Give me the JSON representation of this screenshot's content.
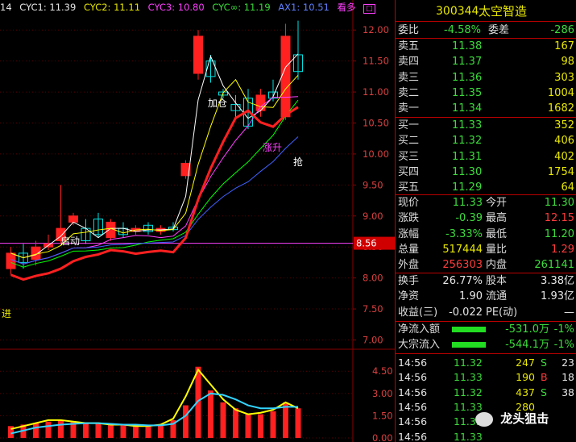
{
  "topbar": {
    "period": "14",
    "cyc1": "CYC1: 11.39",
    "cyc2": "CYC2: 11.11",
    "cyc3": "CYC3: 10.80",
    "cycinf": "CYC∞: 11.19",
    "ax1": "AX1: 10.51",
    "look_more": "看多"
  },
  "annotations": {
    "jiacang": "加仓",
    "zhangsheng": "涨升",
    "qiang": "抢",
    "qidong": "启动",
    "jin": "进"
  },
  "price_axis": [
    "12.00",
    "11.50",
    "11.00",
    "10.50",
    "10.00",
    "9.50",
    "9.00",
    "8.50",
    "8.00",
    "7.50",
    "7.00"
  ],
  "current_price_tag": "8.56",
  "indicator_axis": [
    "4.50",
    "3.00",
    "1.50",
    "0.00"
  ],
  "chart_data": {
    "type": "candlestick",
    "ylim": [
      6.85,
      12.25
    ],
    "candles": [
      {
        "o": 8.15,
        "c": 8.4,
        "h": 8.5,
        "l": 8.05
      },
      {
        "o": 8.4,
        "c": 8.25,
        "h": 8.55,
        "l": 8.15
      },
      {
        "o": 8.3,
        "c": 8.5,
        "h": 8.6,
        "l": 8.2
      },
      {
        "o": 8.5,
        "c": 8.55,
        "h": 8.7,
        "l": 8.45
      },
      {
        "o": 8.6,
        "c": 8.8,
        "h": 9.5,
        "l": 8.55
      },
      {
        "o": 8.9,
        "c": 9.0,
        "h": 9.05,
        "l": 8.85
      },
      {
        "o": 8.8,
        "c": 8.6,
        "h": 8.95,
        "l": 8.55
      },
      {
        "o": 8.95,
        "c": 8.7,
        "h": 9.05,
        "l": 8.65
      },
      {
        "o": 8.65,
        "c": 8.9,
        "h": 8.95,
        "l": 8.6
      },
      {
        "o": 8.8,
        "c": 8.7,
        "h": 8.9,
        "l": 8.65
      },
      {
        "o": 8.75,
        "c": 8.8,
        "h": 8.85,
        "l": 8.7
      },
      {
        "o": 8.85,
        "c": 8.75,
        "h": 8.9,
        "l": 8.7
      },
      {
        "o": 8.75,
        "c": 8.8,
        "h": 8.85,
        "l": 8.7
      },
      {
        "o": 8.82,
        "c": 8.78,
        "h": 8.9,
        "l": 8.75
      },
      {
        "o": 9.65,
        "c": 9.85,
        "h": 9.9,
        "l": 9.6
      },
      {
        "o": 11.3,
        "c": 11.9,
        "h": 12.0,
        "l": 11.2
      },
      {
        "o": 11.5,
        "c": 11.25,
        "h": 11.6,
        "l": 11.15
      },
      {
        "o": 11.0,
        "c": 10.95,
        "h": 11.05,
        "l": 10.9
      },
      {
        "o": 10.8,
        "c": 10.7,
        "h": 10.95,
        "l": 10.6
      },
      {
        "o": 10.9,
        "c": 10.45,
        "h": 11.05,
        "l": 10.4
      },
      {
        "o": 10.7,
        "c": 10.95,
        "h": 11.05,
        "l": 10.6
      },
      {
        "o": 11.0,
        "c": 10.9,
        "h": 11.2,
        "l": 10.85
      },
      {
        "o": 10.6,
        "c": 11.9,
        "h": 12.1,
        "l": 10.55
      },
      {
        "o": 11.6,
        "c": 11.33,
        "h": 12.15,
        "l": 11.2
      }
    ],
    "indicator": {
      "ylim": [
        0,
        5.6
      ],
      "bars": [
        0.8,
        0.9,
        1.0,
        1.1,
        1.2,
        1.1,
        1.0,
        1.0,
        0.9,
        0.9,
        0.8,
        0.8,
        0.9,
        1.2,
        2.2,
        4.8,
        3.2,
        2.4,
        2.0,
        1.6,
        1.6,
        1.8,
        2.4,
        2.0
      ],
      "line1": [
        0.6,
        0.8,
        1.0,
        1.2,
        1.2,
        1.1,
        1.0,
        1.0,
        0.9,
        0.9,
        0.8,
        0.8,
        0.9,
        1.3,
        2.8,
        4.6,
        3.6,
        2.6,
        1.9,
        1.6,
        1.7,
        1.9,
        2.4,
        2.0
      ],
      "line2": [
        0.3,
        0.5,
        0.7,
        0.8,
        0.9,
        0.95,
        1.0,
        1.0,
        0.95,
        0.9,
        0.9,
        0.85,
        0.85,
        0.95,
        1.5,
        2.5,
        3.0,
        2.9,
        2.6,
        2.2,
        2.0,
        2.0,
        2.1,
        2.1
      ]
    }
  },
  "stock": {
    "code": "300344",
    "name": "太空智造"
  },
  "weibi": {
    "label": "委比",
    "value": "-4.58%",
    "label2": "委差",
    "value2": "-286"
  },
  "asks": [
    {
      "label": "卖五",
      "price": "11.38",
      "vol": "167"
    },
    {
      "label": "卖四",
      "price": "11.37",
      "vol": "98"
    },
    {
      "label": "卖三",
      "price": "11.36",
      "vol": "303"
    },
    {
      "label": "卖二",
      "price": "11.35",
      "vol": "1004"
    },
    {
      "label": "卖一",
      "price": "11.34",
      "vol": "1682"
    }
  ],
  "bids": [
    {
      "label": "买一",
      "price": "11.33",
      "vol": "352"
    },
    {
      "label": "买二",
      "price": "11.32",
      "vol": "406"
    },
    {
      "label": "买三",
      "price": "11.31",
      "vol": "402"
    },
    {
      "label": "买四",
      "price": "11.30",
      "vol": "1754"
    },
    {
      "label": "买五",
      "price": "11.29",
      "vol": "64"
    }
  ],
  "quote": [
    {
      "l1": "现价",
      "v1": "11.33",
      "l2": "今开",
      "v2": "11.30",
      "c1": "green",
      "c2": "green"
    },
    {
      "l1": "涨跌",
      "v1": "-0.39",
      "l2": "最高",
      "v2": "12.15",
      "c1": "green",
      "c2": "red"
    },
    {
      "l1": "涨幅",
      "v1": "-3.33%",
      "l2": "最低",
      "v2": "11.20",
      "c1": "green",
      "c2": "green"
    },
    {
      "l1": "总量",
      "v1": "517444",
      "l2": "量比",
      "v2": "1.29",
      "c1": "yellow",
      "c2": "red"
    },
    {
      "l1": "外盘",
      "v1": "256303",
      "l2": "内盘",
      "v2": "261141",
      "c1": "red",
      "c2": "green"
    }
  ],
  "fundamentals": [
    {
      "l1": "换手",
      "v1": "26.77%",
      "l2": "股本",
      "v2": "3.38亿"
    },
    {
      "l1": "净资",
      "v1": "1.90",
      "l2": "流通",
      "v2": "1.93亿"
    },
    {
      "l1": "收益(三)",
      "v1": "-0.022",
      "l2": "PE(动)",
      "v2": "—"
    }
  ],
  "flows": [
    {
      "label": "净流入额",
      "value": "-531.0万",
      "pct": "-1%",
      "fill": 0.6
    },
    {
      "label": "大宗流入",
      "value": "-544.1万",
      "pct": "-1%",
      "fill": 0.6
    }
  ],
  "ticks": [
    {
      "time": "14:56",
      "price": "11.32",
      "vol": "247",
      "side": "S",
      "n": "23",
      "pc": "green",
      "sc": "green"
    },
    {
      "time": "14:56",
      "price": "11.33",
      "vol": "190",
      "side": "B",
      "n": "18",
      "pc": "green",
      "sc": "red"
    },
    {
      "time": "14:56",
      "price": "11.32",
      "vol": "437",
      "side": "S",
      "n": "38",
      "pc": "green",
      "sc": "green"
    },
    {
      "time": "14:56",
      "price": "11.33",
      "vol": "280",
      "side": "",
      "n": "",
      "pc": "green",
      "sc": "green"
    },
    {
      "time": "14:56",
      "price": "11.33",
      "vol": "",
      "side": "",
      "n": "",
      "pc": "green",
      "sc": "green"
    },
    {
      "time": "14:56",
      "price": "11.33",
      "vol": "",
      "side": "",
      "n": "",
      "pc": "green",
      "sc": "green"
    }
  ],
  "watermark": "龙头狙击",
  "colors": {
    "up": "#ff2020",
    "down": "#00e0e0",
    "grid": "#8b0000",
    "ma1": "#ffffff",
    "ma2": "#ffff00",
    "ma3": "#ff40ff",
    "ma4": "#00ff00",
    "ma5": "#4060ff"
  }
}
